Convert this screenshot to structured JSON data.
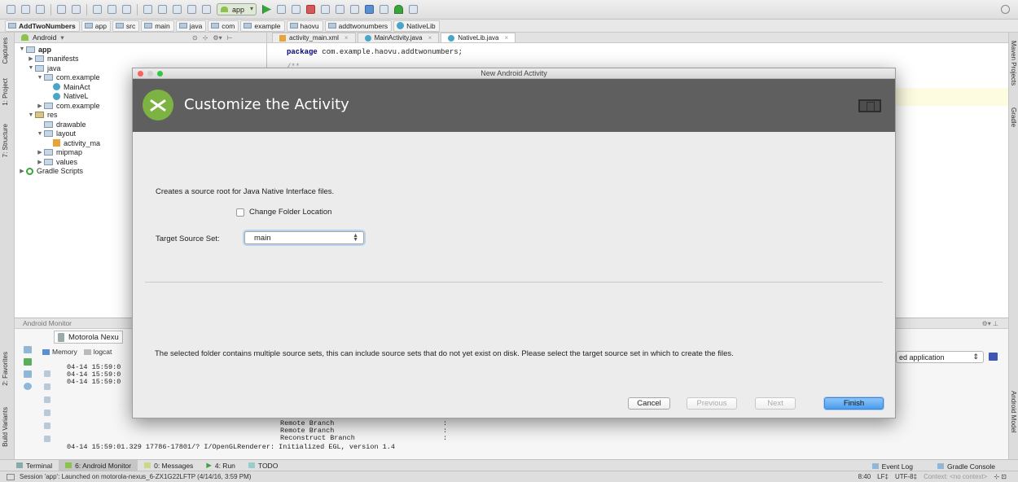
{
  "toolbar": {
    "run_config": "app"
  },
  "breadcrumbs": [
    "AddTwoNumbers",
    "app",
    "src",
    "main",
    "java",
    "com",
    "example",
    "haovu",
    "addtwonumbers",
    "NativeLib"
  ],
  "left_tool_windows": [
    "1: Project",
    "7: Structure",
    "Captures",
    "2: Favorites",
    "Build Variants"
  ],
  "right_tool_windows": [
    "Maven Projects",
    "Gradle",
    "Android Model"
  ],
  "project_panel": {
    "view": "Android",
    "tree": [
      {
        "label": "app",
        "indent": 0,
        "icon": "folder",
        "arrow": "▼",
        "bold": true
      },
      {
        "label": "manifests",
        "indent": 1,
        "icon": "folder",
        "arrow": "▶"
      },
      {
        "label": "java",
        "indent": 1,
        "icon": "folder",
        "arrow": "▼"
      },
      {
        "label": "com.example",
        "indent": 2,
        "icon": "folder",
        "arrow": "▼"
      },
      {
        "label": "MainAct",
        "indent": 3,
        "icon": "class",
        "arrow": ""
      },
      {
        "label": "NativeL",
        "indent": 3,
        "icon": "class",
        "arrow": ""
      },
      {
        "label": "com.example",
        "indent": 2,
        "icon": "folder",
        "arrow": "▶"
      },
      {
        "label": "res",
        "indent": 1,
        "icon": "res",
        "arrow": "▼"
      },
      {
        "label": "drawable",
        "indent": 2,
        "icon": "folder",
        "arrow": ""
      },
      {
        "label": "layout",
        "indent": 2,
        "icon": "folder",
        "arrow": "▼"
      },
      {
        "label": "activity_ma",
        "indent": 3,
        "icon": "xml",
        "arrow": ""
      },
      {
        "label": "mipmap",
        "indent": 2,
        "icon": "folder",
        "arrow": "▶"
      },
      {
        "label": "values",
        "indent": 2,
        "icon": "folder",
        "arrow": "▶"
      },
      {
        "label": "Gradle Scripts",
        "indent": 0,
        "icon": "gradle",
        "arrow": "▶"
      }
    ]
  },
  "editor": {
    "tabs": [
      "activity_main.xml",
      "MainActivity.java",
      "NativeLib.java"
    ],
    "active_tab": 2,
    "code_keyword": "package",
    "code_rest": " com.example.haovu.addtwonumbers;",
    "code_line2": "/**"
  },
  "android_monitor": {
    "title": "Android Monitor",
    "device": "Motorola Nexu",
    "tabs": [
      "Memory",
      "logcat"
    ],
    "log_left": [
      "04-14 15:59:0",
      "04-14 15:59:0",
      "04-14 15:59:0"
    ],
    "log_right": [
      "Remote Branch",
      "Remote Branch",
      "Reconstruct Branch"
    ],
    "log_full": "04-14 15:59:01.329 17786-17801/? I/OpenGLRenderer: Initialized EGL, version 1.4",
    "filter_dropdown": "ed application"
  },
  "bottom_tabs": [
    "Terminal",
    "6: Android Monitor",
    "0: Messages",
    "4: Run",
    "TODO"
  ],
  "bottom_right_tabs": [
    "Event Log",
    "Gradle Console"
  ],
  "status": {
    "message": "Session 'app': Launched on motorola-nexus_6-ZX1G22LFTP (4/14/16, 3:59 PM)",
    "position": "8:40",
    "line_sep": "LF‡",
    "encoding": "UTF-8‡",
    "context": "Context: <no context>"
  },
  "dialog": {
    "window_title": "New Android Activity",
    "banner_title": "Customize the Activity",
    "description": "Creates a source root for Java Native Interface files.",
    "checkbox_label": "Change Folder Location",
    "checkbox_checked": false,
    "target_label": "Target Source Set:",
    "target_value": "main",
    "footer_text": "The selected folder contains multiple source sets, this can include source sets that do not yet exist on disk. Please select the target source set in which to create the files.",
    "buttons": {
      "cancel": "Cancel",
      "previous": "Previous",
      "next": "Next",
      "finish": "Finish"
    }
  },
  "colors": {
    "banner_bg": "#5f5f5f",
    "android_green": "#7cb342",
    "finish_button": "#4a9df0",
    "traffic_red": "#fc5f57",
    "traffic_yellow": "#fdbc2e",
    "traffic_green": "#33c748"
  }
}
